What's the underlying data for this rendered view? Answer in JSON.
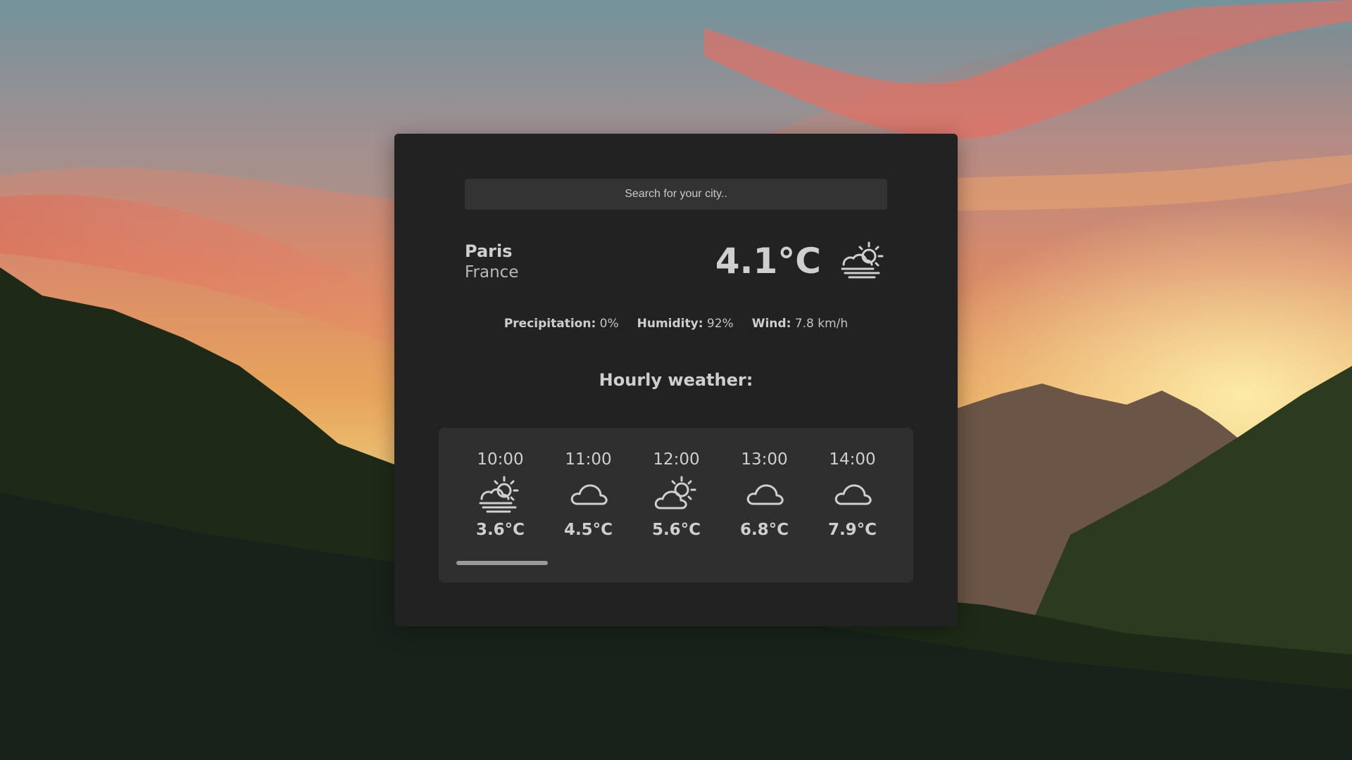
{
  "search": {
    "placeholder": "Search for your city.."
  },
  "location": {
    "city": "Paris",
    "country": "France"
  },
  "current": {
    "temperature": "4.1°C",
    "icon": "partly-cloudy-sun-fog-icon"
  },
  "stats": {
    "precipitation_label": "Precipitation:",
    "precipitation_value": "0%",
    "humidity_label": "Humidity:",
    "humidity_value": "92%",
    "wind_label": "Wind:",
    "wind_value": "7.8 km/h"
  },
  "hourly": {
    "title": "Hourly weather:",
    "items": [
      {
        "time": "10:00",
        "icon": "sun-fog-icon",
        "temp": "3.6°C"
      },
      {
        "time": "11:00",
        "icon": "cloud-icon",
        "temp": "4.5°C"
      },
      {
        "time": "12:00",
        "icon": "partly-cloudy-icon",
        "temp": "5.6°C"
      },
      {
        "time": "13:00",
        "icon": "cloud-icon",
        "temp": "6.8°C"
      },
      {
        "time": "14:00",
        "icon": "cloud-icon",
        "temp": "7.9°C"
      }
    ]
  },
  "colors": {
    "card_background": "#222222",
    "panel_background": "#2f2f2f",
    "text": "#cfcfcf"
  }
}
